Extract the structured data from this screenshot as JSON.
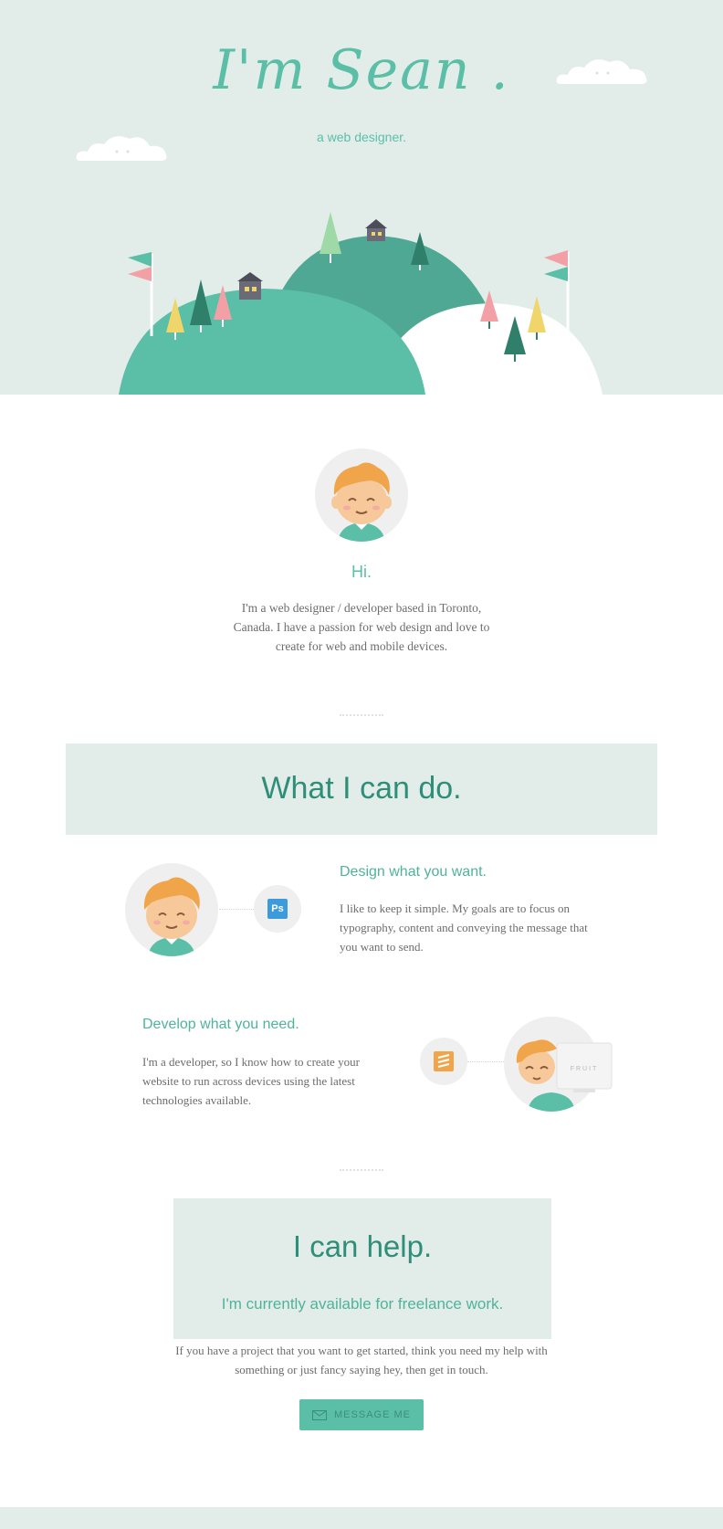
{
  "hero": {
    "title": "I'm Sean .",
    "subtitle": "a web designer."
  },
  "intro": {
    "greeting": "Hi.",
    "text": "I'm a web designer / developer based in Toronto, Canada. I have a passion for web design and love to create for web and mobile devices."
  },
  "skills": {
    "heading": "What I can do.",
    "design": {
      "title": "Design what you want.",
      "text": "I like to keep it simple. My goals are to focus on typography, content and conveying the message that you want to send.",
      "tool_label": "Ps"
    },
    "develop": {
      "title": "Develop what you need.",
      "text": "I'm a developer, so I know how to create your website to run across devices using the latest technologies available.",
      "monitor_label": "FRUIT"
    }
  },
  "contact": {
    "heading": "I can help.",
    "subheading": "I'm currently available for freelance work.",
    "text": "If you have a project that you want to get started, think you need my help with something or just fancy saying hey, then get in touch.",
    "button_label": "MESSAGE ME"
  },
  "colors": {
    "mint_bg": "#e2ede9",
    "teal": "#5bbfa8",
    "dark_teal": "#2f8e78",
    "hill_dark": "#4fa893"
  },
  "icons": [
    "cloud-icon",
    "flag-icon",
    "tree-icon",
    "house-icon",
    "photoshop-icon",
    "sublime-icon",
    "envelope-icon"
  ]
}
